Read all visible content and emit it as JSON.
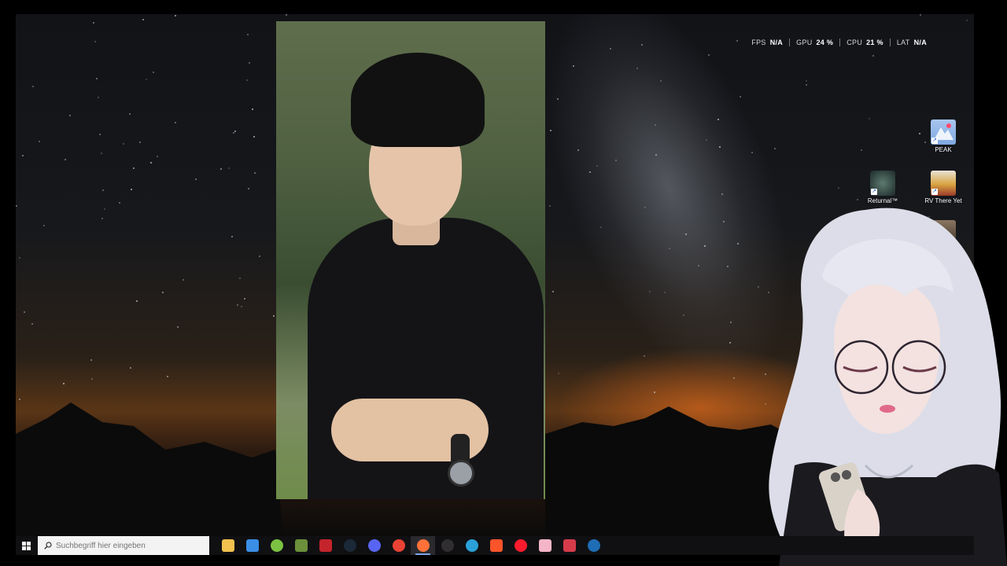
{
  "overlay": {
    "stats": [
      {
        "label": "FPS",
        "value": "N/A"
      },
      {
        "label": "GPU",
        "value": "24 %"
      },
      {
        "label": "CPU",
        "value": "21 %"
      },
      {
        "label": "LAT",
        "value": "N/A"
      }
    ]
  },
  "desktop_icons": [
    {
      "label": "PEAK",
      "icon": "peak-game-icon",
      "color": "#7fa8e0"
    },
    {
      "label": "Returnal™",
      "icon": "returnal-game-icon",
      "color": "#2c3e3a"
    },
    {
      "label": "RV There Yet",
      "icon": "rv-there-yet-game-icon",
      "color": "#d9a441"
    },
    {
      "label": "",
      "icon": "game-shortcut-icon",
      "color": "#6b5a45"
    }
  ],
  "taskbar": {
    "search_placeholder": "Suchbegriff hier eingeben",
    "apps": [
      {
        "name": "file-explorer-icon",
        "glyph": "",
        "color": "#f2c14e",
        "active": false
      },
      {
        "name": "microsoft-store-icon",
        "glyph": "",
        "color": "#3a8ee6",
        "active": false
      },
      {
        "name": "android-studio-icon",
        "glyph": "",
        "color": "#7cc242",
        "active": false
      },
      {
        "name": "minecraft-icon",
        "glyph": "",
        "color": "#6b8f3a",
        "active": false
      },
      {
        "name": "mauz-mixer-icon",
        "glyph": "",
        "color": "#c4242b",
        "active": false
      },
      {
        "name": "steam-icon",
        "glyph": "",
        "color": "#1b2838",
        "active": false
      },
      {
        "name": "discord-icon",
        "glyph": "",
        "color": "#5865f2",
        "active": false
      },
      {
        "name": "chrome-icon",
        "glyph": "",
        "color": "#e94235",
        "active": false
      },
      {
        "name": "firefox-icon",
        "glyph": "",
        "color": "#ff7139",
        "active": true
      },
      {
        "name": "obs-icon",
        "glyph": "",
        "color": "#302e31",
        "active": false
      },
      {
        "name": "edge-icon",
        "glyph": "",
        "color": "#2aa1d8",
        "active": false
      },
      {
        "name": "brave-icon",
        "glyph": "",
        "color": "#fb542b",
        "active": false
      },
      {
        "name": "opera-icon",
        "glyph": "",
        "color": "#ff1b2d",
        "active": false
      },
      {
        "name": "vtube-studio-icon",
        "glyph": "",
        "color": "#f5b5c8",
        "active": false
      },
      {
        "name": "streaming-tool-icon",
        "glyph": "",
        "color": "#d63b4a",
        "active": false
      },
      {
        "name": "steam-secondary-icon",
        "glyph": "",
        "color": "#1e6db5",
        "active": false
      }
    ]
  }
}
